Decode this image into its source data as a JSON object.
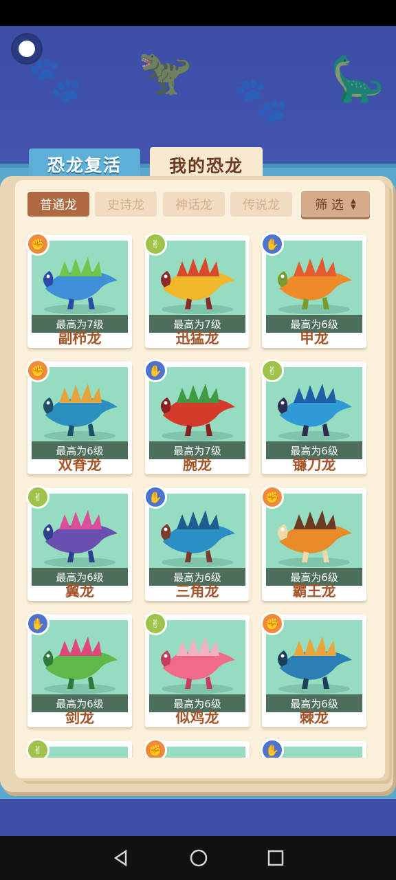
{
  "tabs": {
    "revive": "恐龙复活",
    "mine": "我的恐龙"
  },
  "filters": {
    "tabs": [
      "普通龙",
      "史诗龙",
      "神话龙",
      "传说龙"
    ],
    "active_index": 0,
    "filter_label": "筛 选"
  },
  "cards": [
    {
      "name": "副栉龙",
      "level": "最高为7级",
      "badge": "orange",
      "icon": "rock-hand-icon",
      "colors": [
        "#3f8fd6",
        "#6fc64d",
        "#2b4aa8"
      ]
    },
    {
      "name": "迅猛龙",
      "level": "最高为7级",
      "badge": "green",
      "icon": "scissors-hand-icon",
      "colors": [
        "#f0b72a",
        "#d9482d",
        "#8b2a2a"
      ]
    },
    {
      "name": "甲龙",
      "level": "最高为6级",
      "badge": "blue",
      "icon": "paper-hand-icon",
      "colors": [
        "#ef8a2a",
        "#e65a2f",
        "#7a9c2e"
      ]
    },
    {
      "name": "双脊龙",
      "level": "最高为6级",
      "badge": "orange",
      "icon": "rock-hand-icon",
      "colors": [
        "#2b8fbf",
        "#e6a33a",
        "#1d4f6d"
      ]
    },
    {
      "name": "腕龙",
      "level": "最高为7级",
      "badge": "blue",
      "icon": "paper-hand-icon",
      "colors": [
        "#d63a2b",
        "#3f9a44",
        "#8b1e1e"
      ]
    },
    {
      "name": "镰刀龙",
      "level": "最高为6级",
      "badge": "green",
      "icon": "scissors-hand-icon",
      "colors": [
        "#2f9ad6",
        "#1e5fa8",
        "#2d2d52"
      ]
    },
    {
      "name": "翼龙",
      "level": "最高为6级",
      "badge": "green",
      "icon": "scissors-hand-icon",
      "colors": [
        "#6b4fb0",
        "#d94f9a",
        "#2e3f8c"
      ]
    },
    {
      "name": "三角龙",
      "level": "最高为6级",
      "badge": "blue",
      "icon": "paper-hand-icon",
      "colors": [
        "#2a8fc4",
        "#1f5d8f",
        "#7a3a2e"
      ]
    },
    {
      "name": "霸王龙",
      "level": "最高为6级",
      "badge": "orange",
      "icon": "rock-hand-icon",
      "colors": [
        "#e88a2a",
        "#6b3a22",
        "#f0d9a8"
      ]
    },
    {
      "name": "剑龙",
      "level": "最高为6级",
      "badge": "blue",
      "icon": "paper-hand-icon",
      "colors": [
        "#5fb84a",
        "#e0477a",
        "#2f7a3a"
      ]
    },
    {
      "name": "似鸡龙",
      "level": "最高为6级",
      "badge": "green",
      "icon": "scissors-hand-icon",
      "colors": [
        "#f06a8a",
        "#f3b0c0",
        "#c43f5f"
      ]
    },
    {
      "name": "棘龙",
      "level": "最高为6级",
      "badge": "orange",
      "icon": "rock-hand-icon",
      "colors": [
        "#2b7fb4",
        "#e8a53a",
        "#1c3f5c"
      ]
    },
    {
      "name": "",
      "level": "",
      "badge": "green",
      "icon": "scissors-hand-icon",
      "colors": [
        "#6b4fb0",
        "#2e3f8c",
        "#2e3f8c"
      ]
    },
    {
      "name": "",
      "level": "",
      "badge": "orange",
      "icon": "rock-hand-icon",
      "colors": [
        "#96dcc0",
        "#96dcc0",
        "#96dcc0"
      ]
    },
    {
      "name": "",
      "level": "",
      "badge": "blue",
      "icon": "paper-hand-icon",
      "colors": [
        "#96dcc0",
        "#96dcc0",
        "#96dcc0"
      ]
    }
  ],
  "nav": {
    "back": "back-icon",
    "home": "home-icon",
    "recent": "recent-apps-icon"
  }
}
